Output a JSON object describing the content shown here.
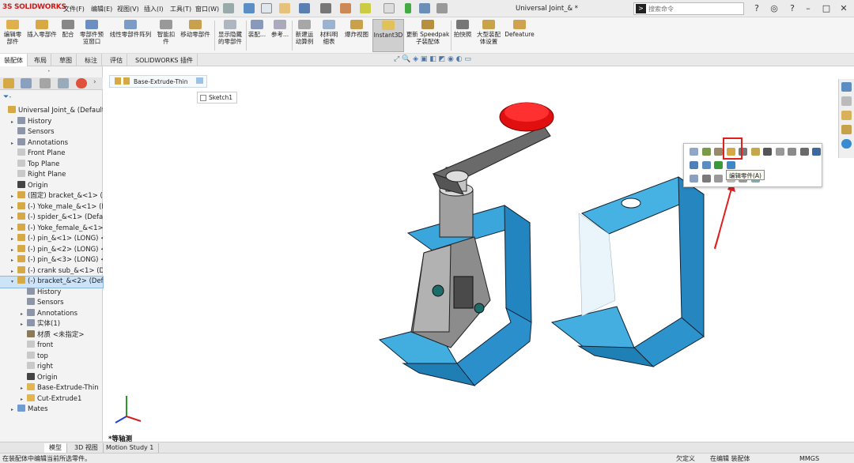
{
  "app": {
    "logo": "SOLIDWORKS",
    "title": "Universal Joint_& *"
  },
  "menu": [
    "文件(F)",
    "编辑(E)",
    "视图(V)",
    "插入(I)",
    "工具(T)",
    "窗口(W)"
  ],
  "search": {
    "placeholder": "搜索命令"
  },
  "ribbon": {
    "buttons": [
      {
        "label": "编辑零\n部件",
        "icon": "edit-component-icon"
      },
      {
        "label": "插入零部件",
        "icon": "insert-component-icon"
      },
      {
        "label": "配合",
        "icon": "mate-icon"
      },
      {
        "label": "零部件预\n览窗口",
        "icon": "preview-icon"
      },
      {
        "label": "线性零部件阵列",
        "icon": "pattern-icon"
      },
      {
        "label": "智能扣\n件",
        "icon": "fastener-icon"
      },
      {
        "label": "移动零部件",
        "icon": "move-icon"
      },
      {
        "label": "显示隐藏\n的零部件",
        "icon": "show-hidden-icon"
      },
      {
        "label": "装配...",
        "icon": "assembly-icon"
      },
      {
        "label": "参考...",
        "icon": "reference-icon"
      },
      {
        "label": "新建运\n动算例",
        "icon": "motion-icon"
      },
      {
        "label": "材料明\n细表",
        "icon": "bom-icon"
      },
      {
        "label": "爆炸视图",
        "icon": "explode-icon"
      },
      {
        "label": "Instant3D",
        "icon": "instant3d-icon"
      },
      {
        "label": "更新 Speedpak\n子装配体",
        "icon": "speedpak-icon"
      },
      {
        "label": "拍快照",
        "icon": "snapshot-icon"
      },
      {
        "label": "大型装配\n体设置",
        "icon": "large-assembly-icon"
      },
      {
        "label": "Defeature",
        "icon": "defeature-icon"
      }
    ]
  },
  "command_tabs": [
    "装配体",
    "布局",
    "草图",
    "标注",
    "评估",
    "SOLIDWORKS 插件"
  ],
  "tree": [
    {
      "label": "Universal Joint_& (Default) <",
      "level": 0,
      "arrow": "",
      "icon": "assembly"
    },
    {
      "label": "History",
      "level": 1,
      "arrow": "▸",
      "icon": "folder"
    },
    {
      "label": "Sensors",
      "level": 1,
      "arrow": "",
      "icon": "folder"
    },
    {
      "label": "Annotations",
      "level": 1,
      "arrow": "▸",
      "icon": "folder"
    },
    {
      "label": "Front Plane",
      "level": 1,
      "arrow": "",
      "icon": "plane"
    },
    {
      "label": "Top Plane",
      "level": 1,
      "arrow": "",
      "icon": "plane"
    },
    {
      "label": "Right Plane",
      "level": 1,
      "arrow": "",
      "icon": "plane"
    },
    {
      "label": "Origin",
      "level": 1,
      "arrow": "",
      "icon": "origin"
    },
    {
      "label": "(固定) bracket_&<1> (De",
      "level": 1,
      "arrow": "▸",
      "icon": "part"
    },
    {
      "label": "(-) Yoke_male_&<1> (De",
      "level": 1,
      "arrow": "▸",
      "icon": "part"
    },
    {
      "label": "(-) spider_&<1> (Default",
      "level": 1,
      "arrow": "▸",
      "icon": "part"
    },
    {
      "label": "(-) Yoke_female_&<1> (D",
      "level": 1,
      "arrow": "▸",
      "icon": "part"
    },
    {
      "label": "(-) pin_&<1> (LONG) <<",
      "level": 1,
      "arrow": "▸",
      "icon": "part"
    },
    {
      "label": "(-) pin_&<2> (LONG) <<",
      "level": 1,
      "arrow": "▸",
      "icon": "part"
    },
    {
      "label": "(-) pin_&<3> (LONG) <<",
      "level": 1,
      "arrow": "▸",
      "icon": "part"
    },
    {
      "label": "(-) crank sub_&<1> (Def",
      "level": 1,
      "arrow": "▸",
      "icon": "part"
    },
    {
      "label": "(-) bracket_&<2> (Defau",
      "level": 1,
      "arrow": "▾",
      "icon": "part",
      "selected": true
    },
    {
      "label": "History",
      "level": 2,
      "arrow": "",
      "icon": "folder"
    },
    {
      "label": "Sensors",
      "level": 2,
      "arrow": "",
      "icon": "folder"
    },
    {
      "label": "Annotations",
      "level": 2,
      "arrow": "▸",
      "icon": "folder"
    },
    {
      "label": "实体(1)",
      "level": 2,
      "arrow": "▸",
      "icon": "folder"
    },
    {
      "label": "材质 <未指定>",
      "level": 2,
      "arrow": "",
      "icon": "material"
    },
    {
      "label": "front",
      "level": 2,
      "arrow": "",
      "icon": "plane"
    },
    {
      "label": "top",
      "level": 2,
      "arrow": "",
      "icon": "plane"
    },
    {
      "label": "right",
      "level": 2,
      "arrow": "",
      "icon": "plane"
    },
    {
      "label": "Origin",
      "level": 2,
      "arrow": "",
      "icon": "origin"
    },
    {
      "label": "Base-Extrude-Thin",
      "level": 2,
      "arrow": "▸",
      "icon": "feature"
    },
    {
      "label": "Cut-Extrude1",
      "level": 2,
      "arrow": "▸",
      "icon": "feature"
    },
    {
      "label": "Mates",
      "level": 1,
      "arrow": "▸",
      "icon": "mates"
    }
  ],
  "breadcrumb": {
    "feature": "Base-Extrude-Thin",
    "sketch": "Sketch1"
  },
  "tooltip": "编辑零件(A)",
  "orientation": "*等轴测",
  "bottom_tabs": [
    "模型",
    "3D 视图",
    "Motion Study 1"
  ],
  "status": {
    "left": "在装配体中编辑当前所选零件。",
    "defined": "欠定义",
    "editing": "在编辑 装配体",
    "units": "MMGS"
  },
  "colors": {
    "accent": "#3a9fd8",
    "bracket": "#2f9bd6",
    "red_knob": "#e01010",
    "steel": "#8a8a8a"
  }
}
